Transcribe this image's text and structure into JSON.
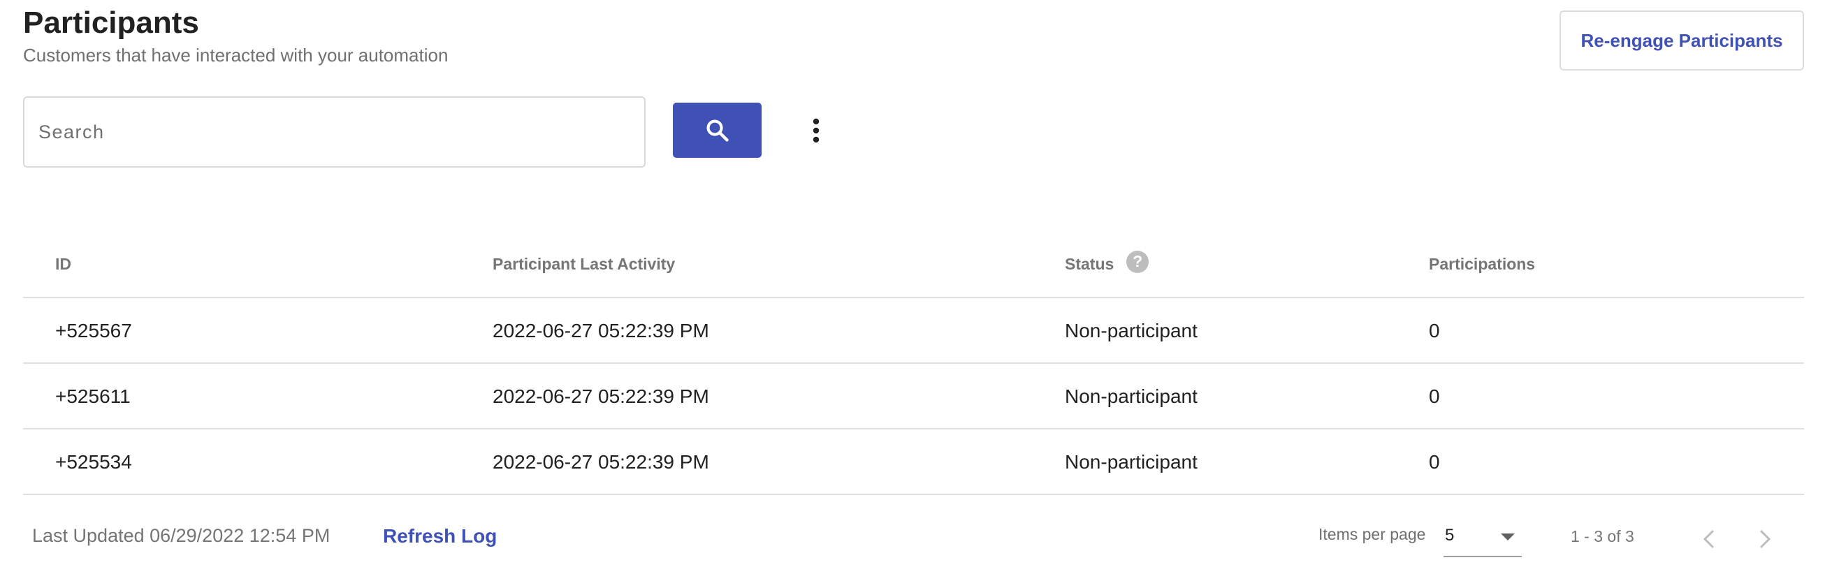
{
  "header": {
    "title": "Participants",
    "subtitle": "Customers that have interacted with your  automation",
    "reengage_label": "Re-engage Participants"
  },
  "search": {
    "placeholder": "Search",
    "value": "",
    "button_icon": "search-icon",
    "more_icon": "more-vert-icon"
  },
  "table": {
    "columns": [
      "ID",
      "Participant Last Activity",
      "Status",
      "Participations"
    ],
    "status_help_icon": "help-icon",
    "status_help_glyph": "?",
    "rows": [
      {
        "id": "+525567",
        "last_activity": "2022-06-27 05:22:39 PM",
        "status": "Non-participant",
        "participations": "0"
      },
      {
        "id": "+525611",
        "last_activity": "2022-06-27 05:22:39 PM",
        "status": "Non-participant",
        "participations": "0"
      },
      {
        "id": "+525534",
        "last_activity": "2022-06-27 05:22:39 PM",
        "status": "Non-participant",
        "participations": "0"
      }
    ]
  },
  "footer": {
    "last_updated": "Last Updated 06/29/2022 12:54 PM",
    "refresh_label": "Refresh Log",
    "items_per_page_label": "Items per page",
    "items_per_page_value": "5",
    "range_label": "1 - 3 of 3",
    "prev_icon": "chevron-left-icon",
    "next_icon": "chevron-right-icon"
  },
  "colors": {
    "accent": "#3f51b5",
    "border": "#e0e0e0",
    "muted_text": "#757575"
  }
}
